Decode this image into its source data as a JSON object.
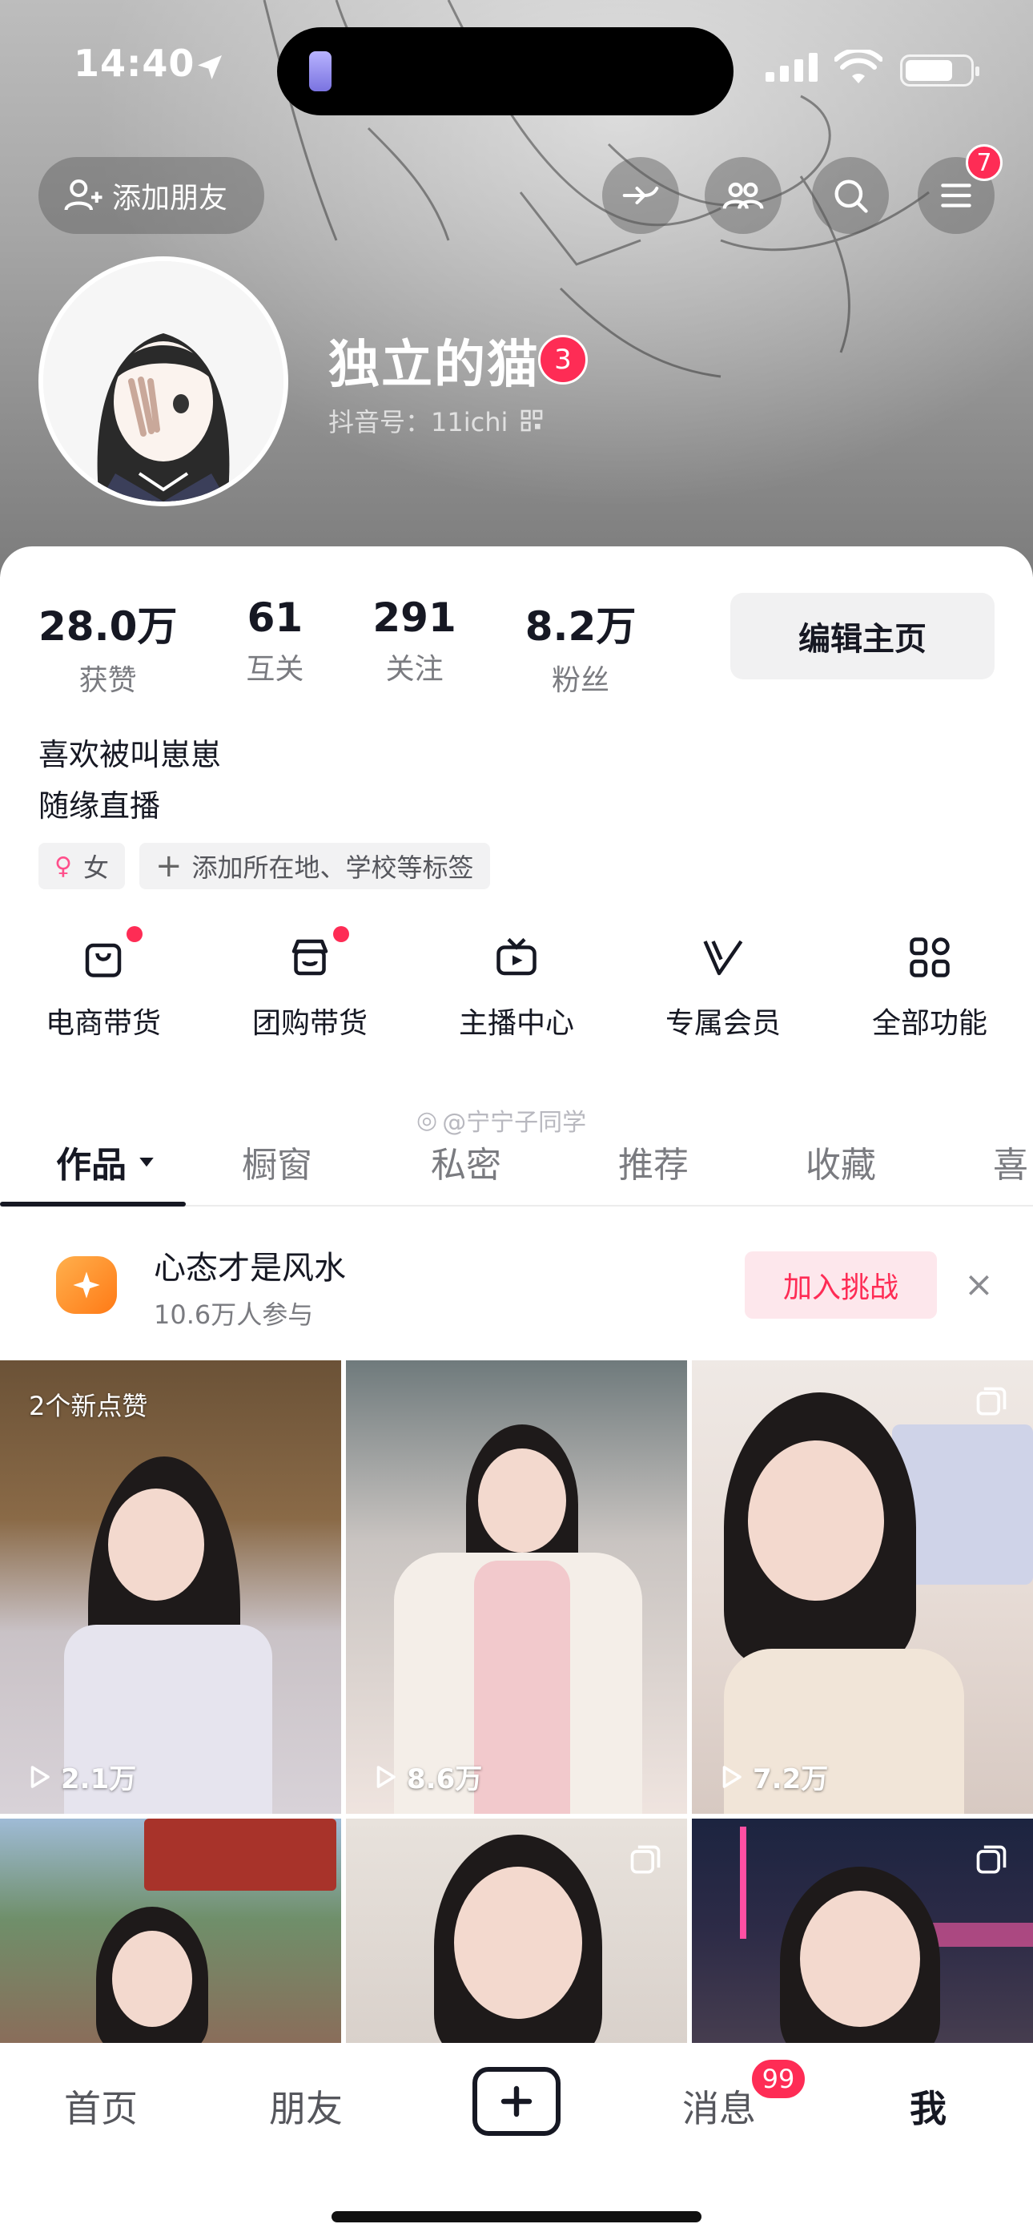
{
  "status_bar": {
    "time": "14:40"
  },
  "header": {
    "add_friend_label": "添加朋友",
    "menu_badge": "7",
    "nickname": "独立的猫",
    "nickname_badge": "3",
    "douyin_id": "抖音号：11ichi"
  },
  "stats": [
    {
      "value": "28.0万",
      "label": "获赞"
    },
    {
      "value": "61",
      "label": "互关"
    },
    {
      "value": "291",
      "label": "关注"
    },
    {
      "value": "8.2万",
      "label": "粉丝"
    }
  ],
  "edit_profile_label": "编辑主页",
  "bio": {
    "line1": "喜欢被叫崽崽",
    "line2": "随缘直播"
  },
  "tags": {
    "gender": "女",
    "add_tag": "添加所在地、学校等标签"
  },
  "features": [
    {
      "label": "电商带货",
      "icon": "shopping-bag-icon",
      "dot": true
    },
    {
      "label": "团购带货",
      "icon": "store-icon",
      "dot": true
    },
    {
      "label": "主播中心",
      "icon": "tv-play-icon",
      "dot": false
    },
    {
      "label": "专属会员",
      "icon": "vip-v-icon",
      "dot": false
    },
    {
      "label": "全部功能",
      "icon": "grid-apps-icon",
      "dot": false
    }
  ],
  "tabs": [
    "作品",
    "橱窗",
    "私密",
    "推荐",
    "收藏",
    "喜"
  ],
  "watermark": "@宁宁子同学",
  "challenge": {
    "title": "心态才是风水",
    "subtitle": "10.6万人参与",
    "join_label": "加入挑战",
    "close": "×"
  },
  "videos": [
    {
      "views": "2.1万",
      "badge": "2个新点赞",
      "multi": false
    },
    {
      "views": "8.6万",
      "badge": "",
      "multi": false
    },
    {
      "views": "7.2万",
      "badge": "",
      "multi": true
    },
    {
      "views": "",
      "badge": "",
      "multi": true
    },
    {
      "views": "",
      "badge": "",
      "multi": true
    },
    {
      "views": "",
      "badge": "",
      "multi": true
    }
  ],
  "bottom_nav": {
    "home": "首页",
    "friends": "朋友",
    "messages": "消息",
    "messages_badge": "99",
    "me": "我"
  },
  "colors": {
    "accent": "#fe2c55",
    "text": "#161823",
    "muted": "#7a7b80"
  }
}
